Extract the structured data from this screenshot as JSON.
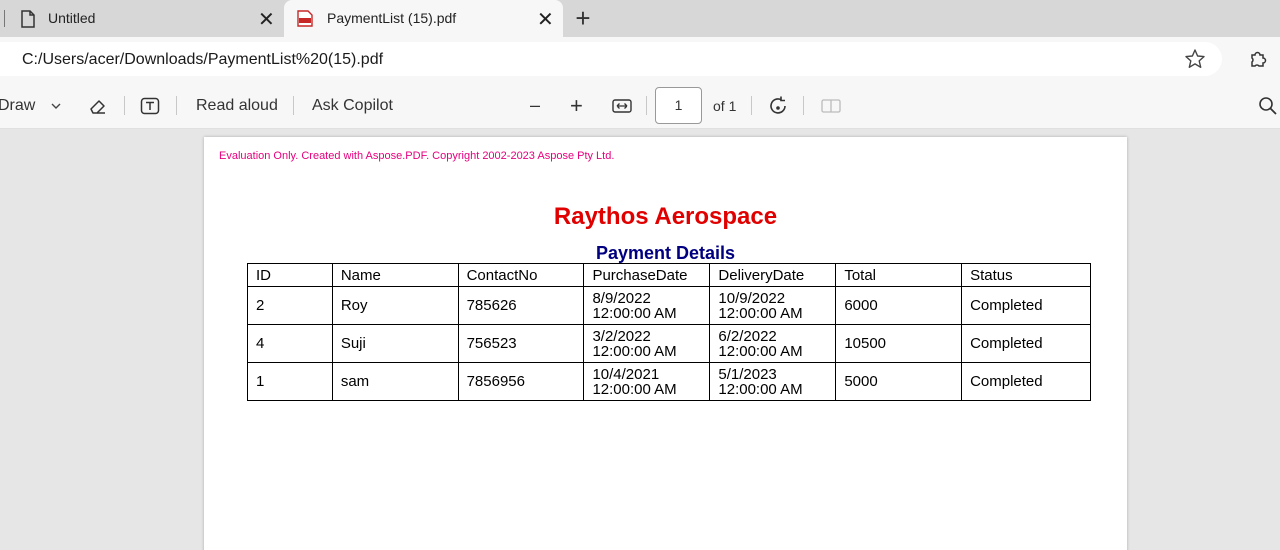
{
  "tabs": [
    {
      "title": "Untitled",
      "active": false
    },
    {
      "title": "PaymentList (15).pdf",
      "active": true
    }
  ],
  "tab_close_glyph": "✕",
  "new_tab_glyph": "+",
  "address": {
    "url": "C:/Users/acer/Downloads/PaymentList%20(15).pdf"
  },
  "toolbar": {
    "draw_label": "Draw",
    "read_aloud_label": "Read aloud",
    "ask_copilot_label": "Ask Copilot",
    "zoom_out_glyph": "–",
    "zoom_in_glyph": "+",
    "page_number": "1",
    "page_of": "of 1"
  },
  "document": {
    "watermark": "Evaluation Only. Created with Aspose.PDF. Copyright 2002-2023 Aspose Pty Ltd.",
    "company": "Raythos Aerospace",
    "subtitle": "Payment Details",
    "columns": [
      "ID",
      "Name",
      "ContactNo",
      "PurchaseDate",
      "DeliveryDate",
      "Total",
      "Status"
    ],
    "rows": [
      {
        "id": "2",
        "name": "Roy",
        "contact": "785626",
        "purchase_date": "8/9/2022",
        "purchase_time": "12:00:00 AM",
        "delivery_date": "10/9/2022",
        "delivery_time": "12:00:00 AM",
        "total": "6000",
        "status": "Completed"
      },
      {
        "id": "4",
        "name": "Suji",
        "contact": "756523",
        "purchase_date": "3/2/2022",
        "purchase_time": "12:00:00 AM",
        "delivery_date": "6/2/2022",
        "delivery_time": "12:00:00 AM",
        "total": "10500",
        "status": "Completed"
      },
      {
        "id": "1",
        "name": "sam",
        "contact": "7856956",
        "purchase_date": "10/4/2021",
        "purchase_time": "12:00:00 AM",
        "delivery_date": "5/1/2023",
        "delivery_time": "12:00:00 AM",
        "total": "5000",
        "status": "Completed"
      }
    ]
  },
  "colors": {
    "watermark": "#e6007e",
    "company": "#e00000",
    "subtitle": "#000080"
  }
}
